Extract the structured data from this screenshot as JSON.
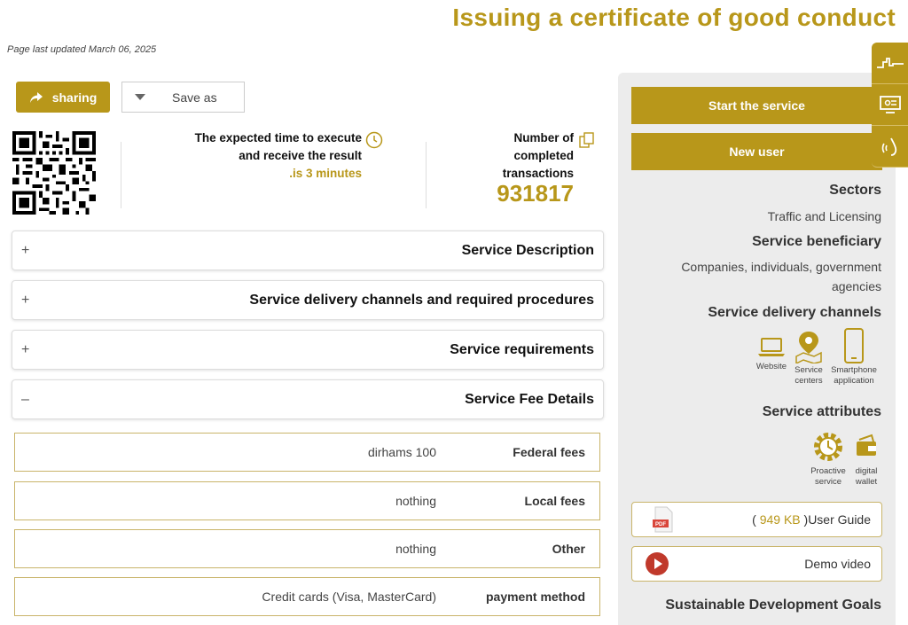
{
  "page": {
    "title": "Issuing a certificate of good conduct",
    "last_updated": "Page last updated March 06, 2025"
  },
  "toolbar": {
    "share_label": "sharing",
    "save_label": "Save as"
  },
  "stats": {
    "expected_time_line1": "The expected time to execute",
    "expected_time_line2": "and receive the result",
    "expected_time_value": ".is 3 minutes",
    "transactions_line1": "Number of",
    "transactions_line2": "completed",
    "transactions_line3": "transactions",
    "transactions_value": "931817"
  },
  "accordion": [
    {
      "sign": "+",
      "label": "Service Description"
    },
    {
      "sign": "+",
      "label": "Service delivery channels and required procedures"
    },
    {
      "sign": "+",
      "label": "Service requirements"
    },
    {
      "sign": "–",
      "label": "Service Fee Details"
    }
  ],
  "fees": [
    {
      "label": "Federal fees",
      "value": "dirhams 100"
    },
    {
      "label": "Local fees",
      "value": "nothing"
    },
    {
      "label": "Other",
      "value": "nothing"
    },
    {
      "label": "payment method",
      "value": "Credit cards (Visa, MasterCard)"
    }
  ],
  "sidebar": {
    "start_label": "Start the service",
    "new_user_label": "New user",
    "sectors_heading": "Sectors",
    "sectors_value": "Traffic and Licensing",
    "beneficiary_heading": "Service beneficiary",
    "beneficiary_line1": "Companies, individuals, government",
    "beneficiary_line2": "agencies",
    "channels_heading": "Service delivery channels",
    "channels": [
      {
        "icon": "laptop-icon",
        "line1": "Website",
        "line2": ""
      },
      {
        "icon": "map-pin-icon",
        "line1": "Service",
        "line2": "centers"
      },
      {
        "icon": "smartphone-icon",
        "line1": "Smartphone",
        "line2": "application"
      }
    ],
    "attributes_heading": "Service attributes",
    "attributes": [
      {
        "icon": "gear-clock-icon",
        "line1": "Proactive",
        "line2": "service"
      },
      {
        "icon": "wallet-icon",
        "line1": "digital",
        "line2": "wallet"
      }
    ],
    "guide_prefix": "( ",
    "guide_size": "949 KB",
    "guide_suffix": " )User Guide",
    "pdf_badge": "PDF",
    "demo_label": "Demo video",
    "sdg_heading": "Sustainable Development Goals"
  },
  "colors": {
    "accent": "#b8971a",
    "sidebar_bg": "#ececec",
    "play": "#c0392b"
  }
}
